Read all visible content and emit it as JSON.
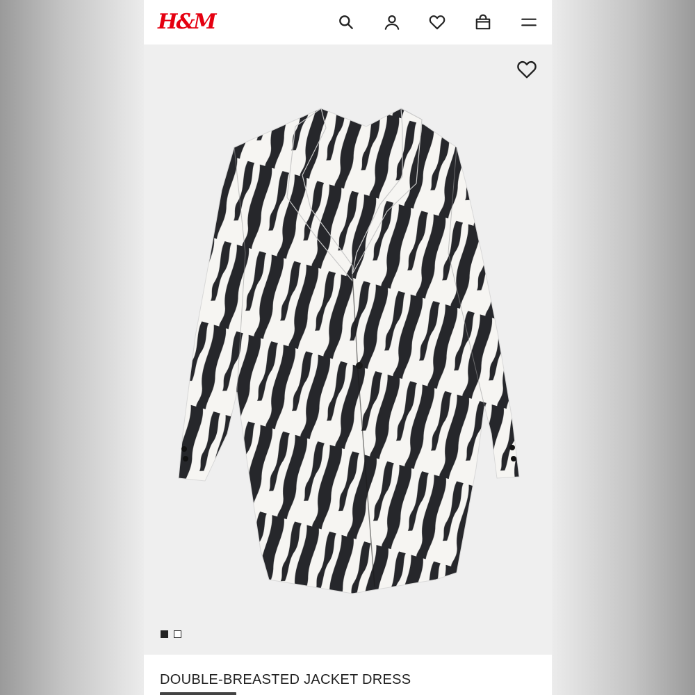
{
  "app": {
    "brand": "H&M",
    "brand_color": "#e50010"
  },
  "header": {
    "icons": [
      "search-icon",
      "account-icon",
      "favorites-icon",
      "shopping-bag-icon",
      "menu-icon"
    ]
  },
  "product": {
    "title": "DOUBLE-BREASTED JACKET DRESS",
    "image_icon": "zebra-print-dress-image",
    "gallery": {
      "count": 2,
      "active_index": 0
    },
    "favorite_icon": "heart-icon"
  },
  "colors": {
    "page_bg": "#ececec",
    "media_bg": "#efefef",
    "text": "#222222"
  }
}
